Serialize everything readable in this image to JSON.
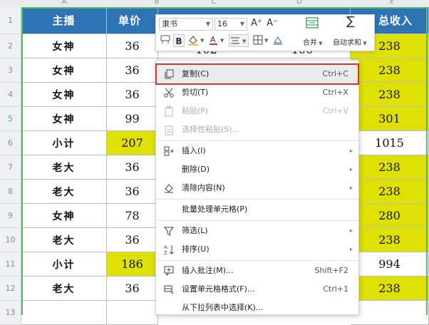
{
  "sheet": {
    "columns": [
      "A",
      "B",
      "C",
      "D",
      "E"
    ],
    "row_numbers": [
      "1",
      "2",
      "3",
      "4",
      "5",
      "6",
      "7",
      "8",
      "9",
      "10",
      "11",
      "12",
      "13"
    ],
    "header": {
      "anchor": "主播",
      "price": "单价",
      "revenue": "总收入"
    },
    "rows": [
      {
        "anchor": "女神",
        "price": "36",
        "revenue": "238"
      },
      {
        "anchor": "女神",
        "price": "36",
        "revenue": "238"
      },
      {
        "anchor": "女神",
        "price": "36",
        "revenue": "238"
      },
      {
        "anchor": "女神",
        "price": "99",
        "revenue": "301"
      },
      {
        "anchor": "小计",
        "price": "207",
        "revenue": "1015"
      },
      {
        "anchor": "老大",
        "price": "36",
        "revenue": "238"
      },
      {
        "anchor": "老大",
        "price": "36",
        "revenue": "238"
      },
      {
        "anchor": "女神",
        "price": "78",
        "revenue": "280"
      },
      {
        "anchor": "老大",
        "price": "36",
        "revenue": "238"
      },
      {
        "anchor": "小计",
        "price": "186",
        "revenue": "994"
      },
      {
        "anchor": "老大",
        "price": "36",
        "revenue": "238"
      }
    ],
    "partial_c2": "102",
    "partial_d2": "100",
    "colors": {
      "header_bg": "#2e74b5",
      "highlight_yellow": "#dde000",
      "selection_green": "#5cb85c"
    }
  },
  "mini_toolbar": {
    "font_name": "隶书",
    "font_size": "16",
    "increase_font": "A⁺",
    "decrease_font": "A⁻",
    "bold": "B",
    "merge_label": "合并",
    "autosum_label": "自动求和",
    "icons": [
      "format-painter-icon",
      "fill-color-icon",
      "font-color-icon",
      "align-center-icon",
      "borders-icon",
      "clear-icon",
      "merge-cells-icon",
      "sum-icon"
    ]
  },
  "context_menu": {
    "items": [
      {
        "label": "复制(C)",
        "shortcut": "Ctrl+C",
        "icon": "copy-icon",
        "disabled": false,
        "highlighted": true
      },
      {
        "label": "剪切(T)",
        "shortcut": "Ctrl+X",
        "icon": "scissors-icon",
        "disabled": false
      },
      {
        "label": "粘贴(P)",
        "shortcut": "Ctrl+V",
        "icon": "paste-icon",
        "disabled": true
      },
      {
        "label": "选择性粘贴(S)...",
        "shortcut": "",
        "icon": "paste-special-icon",
        "disabled": true
      },
      {
        "label": "插入(I)",
        "shortcut": "",
        "icon": "insert-icon",
        "submenu": true
      },
      {
        "label": "删除(D)",
        "shortcut": "",
        "icon": "",
        "submenu": true
      },
      {
        "label": "清除内容(N)",
        "shortcut": "",
        "icon": "eraser-icon",
        "submenu": true
      },
      {
        "label": "批量处理单元格(P)",
        "shortcut": "",
        "icon": ""
      },
      {
        "label": "筛选(L)",
        "shortcut": "",
        "icon": "filter-icon",
        "submenu": true
      },
      {
        "label": "排序(U)",
        "shortcut": "",
        "icon": "sort-icon",
        "submenu": true
      },
      {
        "label": "插入批注(M)...",
        "shortcut": "Shift+F2",
        "icon": "comment-icon"
      },
      {
        "label": "设置单元格格式(F)...",
        "shortcut": "Ctrl+1",
        "icon": "format-cells-icon"
      },
      {
        "label": "从下拉列表中选择(K)...",
        "shortcut": "",
        "icon": ""
      }
    ],
    "highlight_color": "#e0312b"
  }
}
